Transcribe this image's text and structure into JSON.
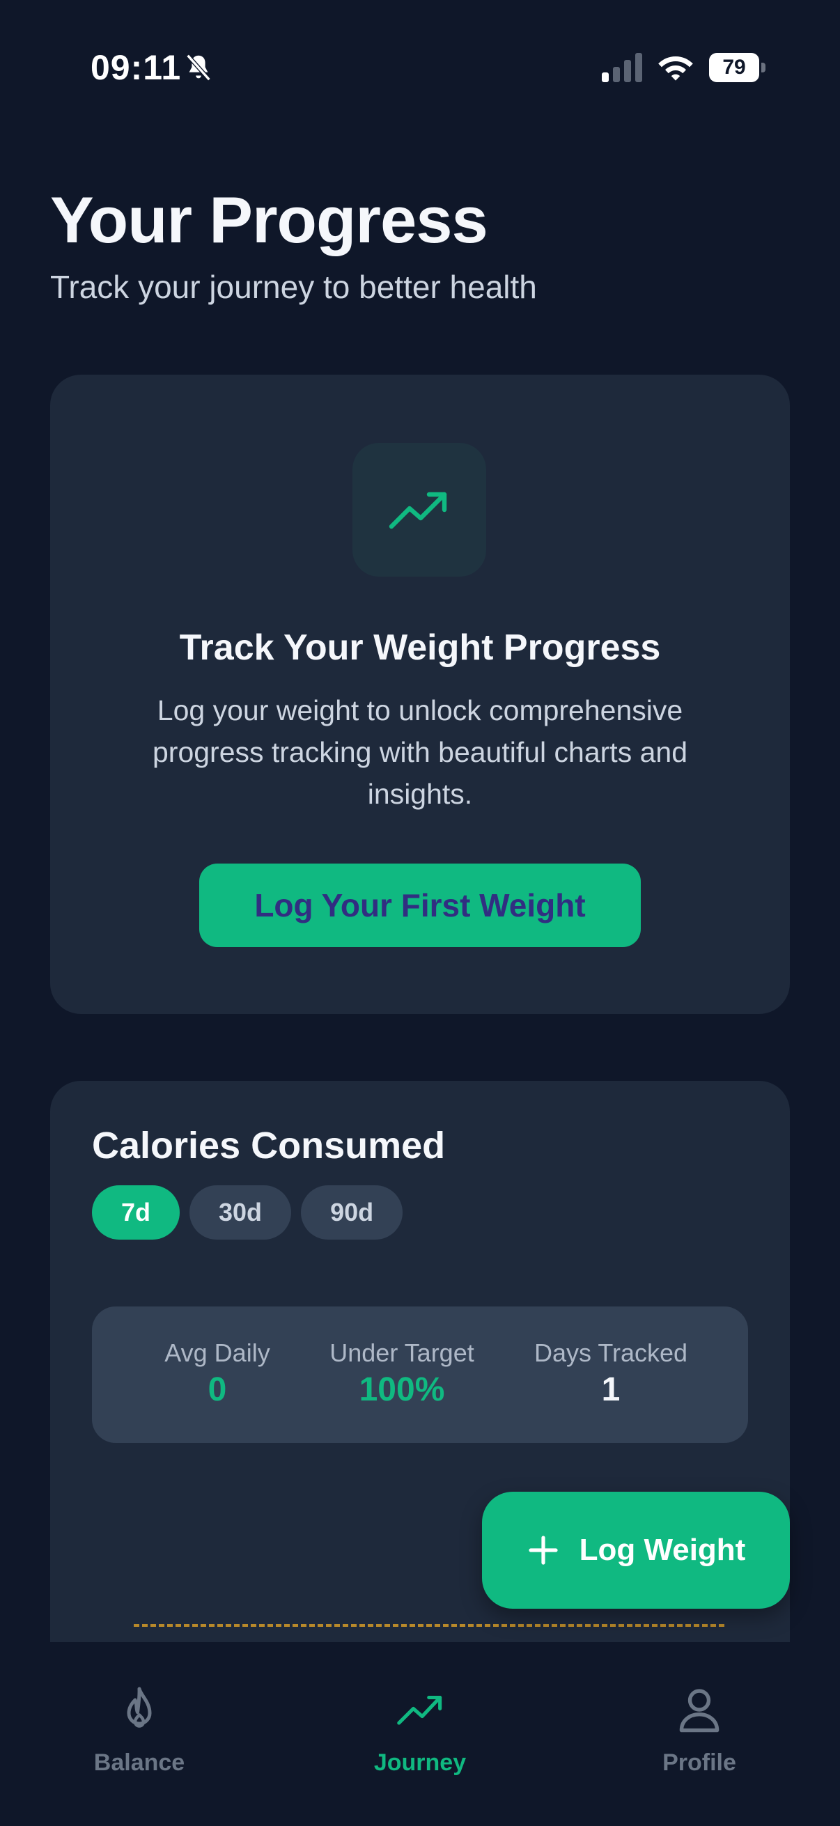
{
  "status_bar": {
    "time": "09:11",
    "battery": "79",
    "icons": [
      "bell-muted-icon",
      "signal-icon",
      "wifi-icon",
      "battery-icon"
    ]
  },
  "header": {
    "title": "Your Progress",
    "subtitle": "Track your journey to better health"
  },
  "weight_card": {
    "icon": "trending-up-icon",
    "title": "Track Your Weight Progress",
    "description": "Log your weight to unlock comprehensive progress tracking with beautiful charts and insights.",
    "button_label": "Log Your First Weight"
  },
  "calories_card": {
    "title": "Calories Consumed",
    "ranges": [
      {
        "label": "7d",
        "active": true
      },
      {
        "label": "30d",
        "active": false
      },
      {
        "label": "90d",
        "active": false
      }
    ],
    "stats": [
      {
        "label": "Avg Daily",
        "value": "0",
        "color": "#10b981"
      },
      {
        "label": "Under Target",
        "value": "100%",
        "color": "#10b981"
      },
      {
        "label": "Days Tracked",
        "value": "1",
        "color": "#f5f7fb"
      }
    ]
  },
  "fab": {
    "icon": "plus-icon",
    "label": "Log Weight"
  },
  "bottom_nav": {
    "items": [
      {
        "label": "Balance",
        "icon": "flame-icon",
        "active": false
      },
      {
        "label": "Journey",
        "icon": "trending-up-icon",
        "active": true
      },
      {
        "label": "Profile",
        "icon": "user-icon",
        "active": false
      }
    ]
  },
  "colors": {
    "background": "#0f1729",
    "card": "#1e293b",
    "accent": "#10b981",
    "button_text": "#312e81",
    "target_line": "#b8892a"
  }
}
